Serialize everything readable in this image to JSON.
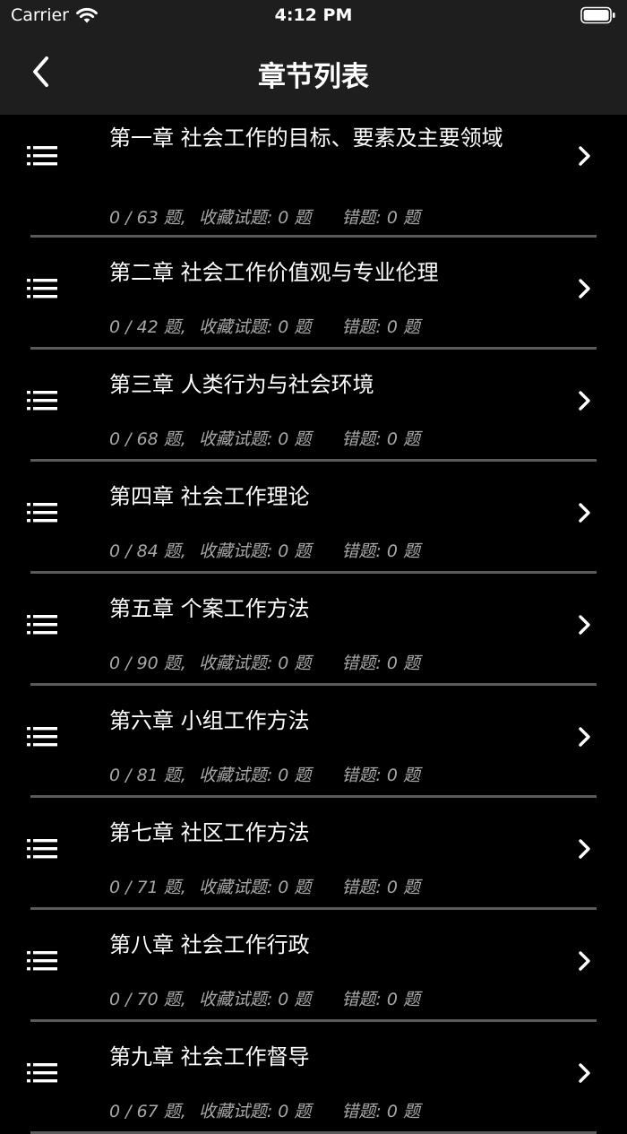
{
  "status_bar": {
    "carrier": "Carrier",
    "time": "4:12 PM"
  },
  "nav": {
    "title": "章节列表"
  },
  "chapters": [
    {
      "title": "第一章 社会工作的目标、要素及主要领域",
      "progress": "0 / 63 题,",
      "favorites": "收藏试题: 0 题",
      "errors": "错题: 0 题"
    },
    {
      "title": "第二章 社会工作价值观与专业伦理",
      "progress": "0 / 42 题,",
      "favorites": "收藏试题: 0 题",
      "errors": "错题: 0 题"
    },
    {
      "title": "第三章 人类行为与社会环境",
      "progress": "0 / 68 题,",
      "favorites": "收藏试题: 0 题",
      "errors": "错题: 0 题"
    },
    {
      "title": "第四章 社会工作理论",
      "progress": "0 / 84 题,",
      "favorites": "收藏试题: 0 题",
      "errors": "错题: 0 题"
    },
    {
      "title": "第五章 个案工作方法",
      "progress": "0 / 90 题,",
      "favorites": "收藏试题: 0 题",
      "errors": "错题: 0 题"
    },
    {
      "title": "第六章 小组工作方法",
      "progress": "0 / 81 题,",
      "favorites": "收藏试题: 0 题",
      "errors": "错题: 0 题"
    },
    {
      "title": "第七章 社区工作方法",
      "progress": "0 / 71 题,",
      "favorites": "收藏试题: 0 题",
      "errors": "错题: 0 题"
    },
    {
      "title": "第八章 社会工作行政",
      "progress": "0 / 70 题,",
      "favorites": "收藏试题: 0 题",
      "errors": "错题: 0 题"
    },
    {
      "title": "第九章 社会工作督导",
      "progress": "0 / 67 题,",
      "favorites": "收藏试题: 0 题",
      "errors": "错题: 0 题"
    }
  ]
}
